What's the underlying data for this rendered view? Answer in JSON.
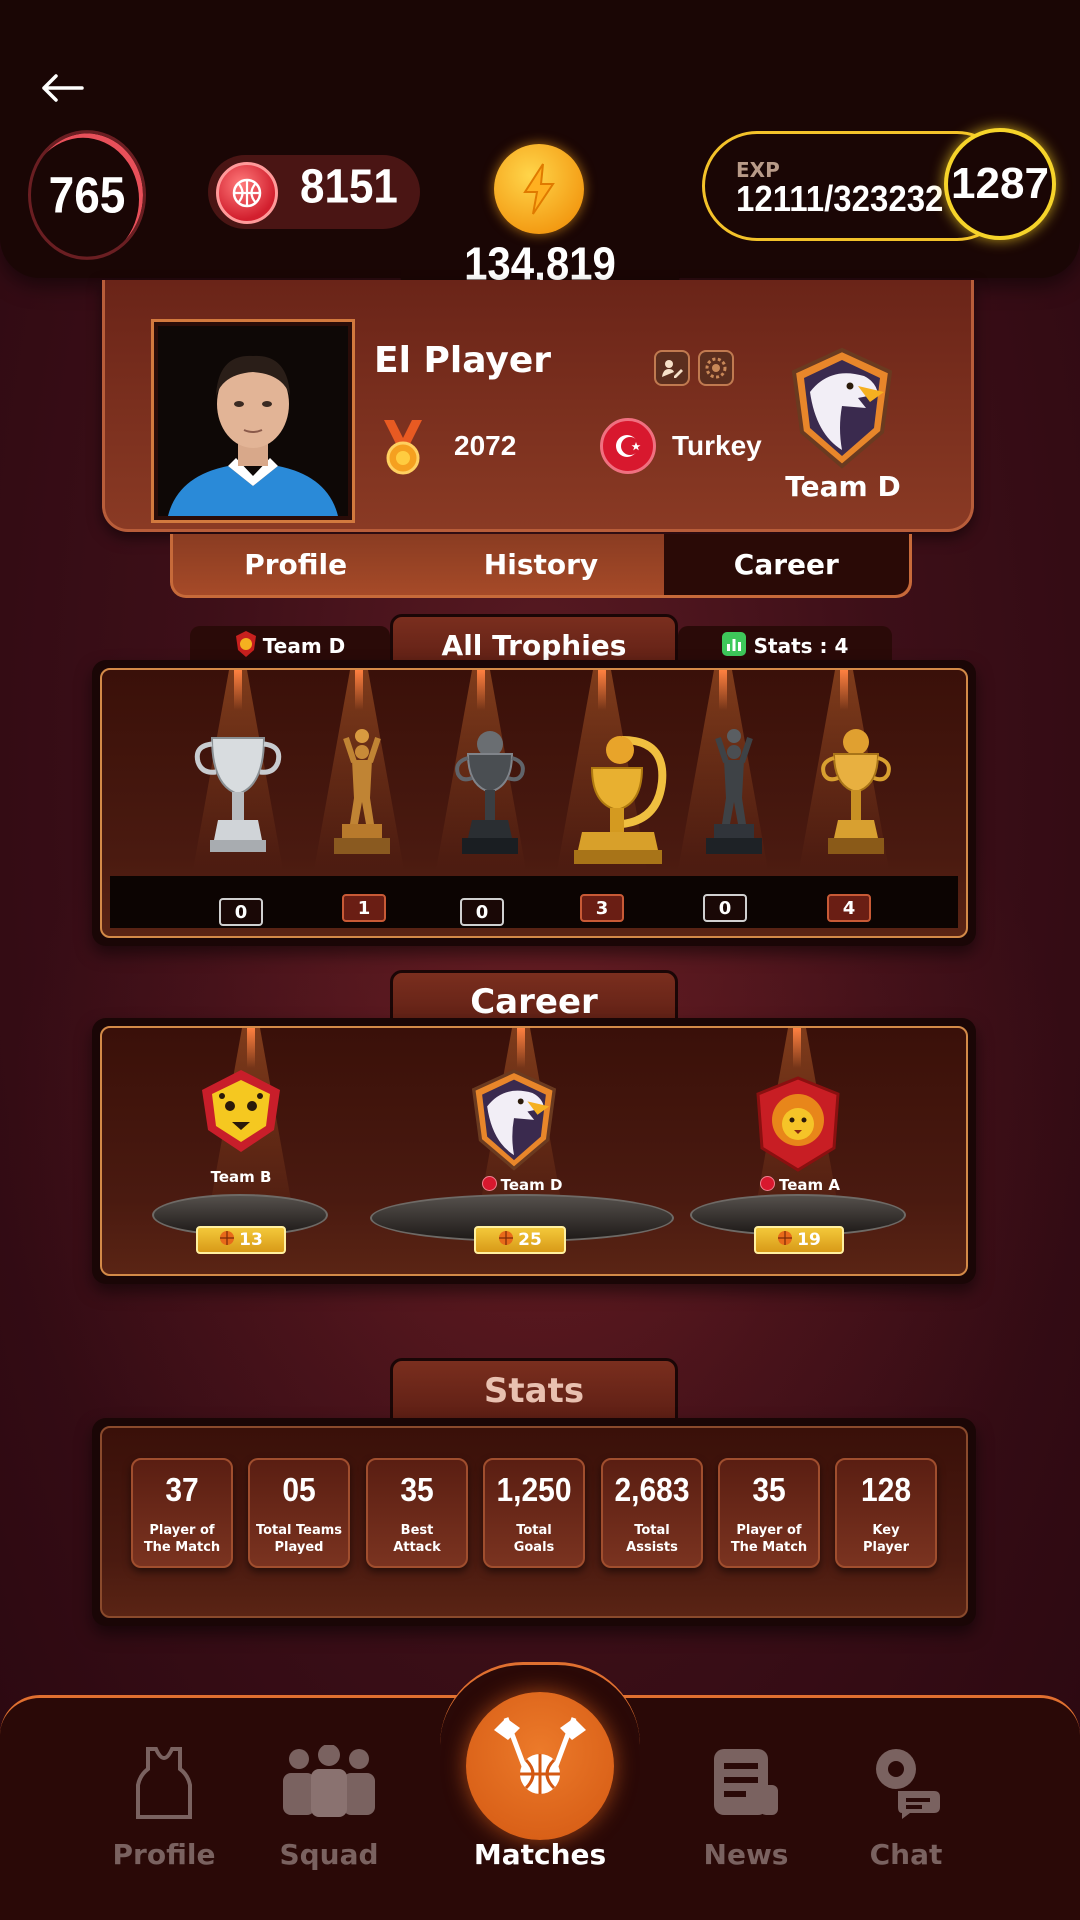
{
  "top_bar": {
    "back_label": "←",
    "level_ring": "765",
    "balls": "8151",
    "coins": "134,819",
    "exp_label": "EXP",
    "exp_value": "12111/323232",
    "exp_level": "1287"
  },
  "profile": {
    "name": "El Player",
    "rank": "2072",
    "country": "Turkey",
    "team": "Team D"
  },
  "tabs": [
    {
      "label": "Profile",
      "active": false
    },
    {
      "label": "History",
      "active": false
    },
    {
      "label": "Career",
      "active": true
    }
  ],
  "trophies_section": {
    "left_tab": "Team D",
    "title": "All Trophies",
    "right_tab": "Stats : 4",
    "counts": [
      "0",
      "1",
      "0",
      "3",
      "0",
      "4"
    ]
  },
  "career": {
    "title": "Career",
    "teams": [
      {
        "name": "Team B",
        "count": "13"
      },
      {
        "name": "Team D",
        "count": "25"
      },
      {
        "name": "Team A",
        "count": "19"
      }
    ]
  },
  "stats": {
    "title": "Stats",
    "items": [
      {
        "value": "37",
        "label": "Player of\nThe Match"
      },
      {
        "value": "05",
        "label": "Total Teams\nPlayed"
      },
      {
        "value": "35",
        "label": "Best\nAttack"
      },
      {
        "value": "1,250",
        "label": "Total\nGoals"
      },
      {
        "value": "2,683",
        "label": "Total\nAssists"
      },
      {
        "value": "35",
        "label": "Player of\nThe Match"
      },
      {
        "value": "128",
        "label": "Key\nPlayer"
      }
    ]
  },
  "bottom_nav": {
    "profile": "Profile",
    "squad": "Squad",
    "matches": "Matches",
    "news": "News",
    "chat": "Chat"
  }
}
